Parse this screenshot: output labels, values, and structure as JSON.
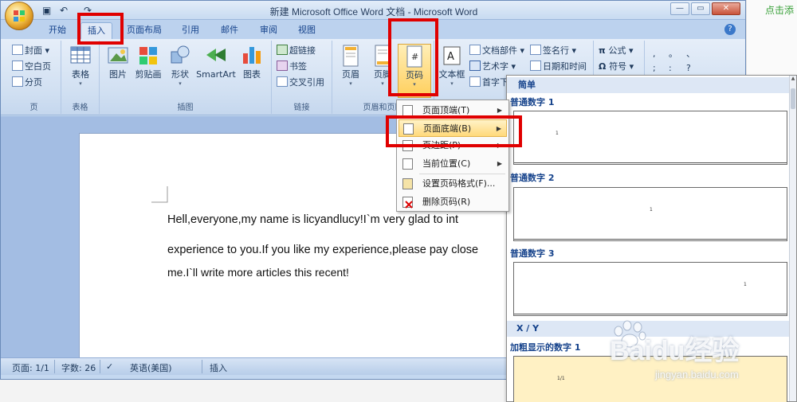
{
  "window": {
    "title": "新建 Microsoft Office Word 文档 - Microsoft Word",
    "controls": [
      "—",
      "▭",
      "✕"
    ]
  },
  "tabs": [
    "开始",
    "插入",
    "页面布局",
    "引用",
    "邮件",
    "审阅",
    "视图"
  ],
  "active_tab": "插入",
  "ribbon": {
    "pages_group": {
      "label": "页",
      "items": [
        "封面",
        "空白页",
        "分页"
      ]
    },
    "tables_group": {
      "label": "表格",
      "table_button": "表格"
    },
    "illustrations_group": {
      "label": "插图",
      "buttons": [
        "图片",
        "剪贴画",
        "形状",
        "SmartArt",
        "图表"
      ]
    },
    "links_group": {
      "label": "链接",
      "items": [
        "超链接",
        "书签",
        "交叉引用"
      ]
    },
    "header_footer_group": {
      "label": "页眉和页脚",
      "buttons": [
        "页眉",
        "页脚",
        "页码"
      ]
    },
    "text_group": {
      "textbox": "文本框",
      "items_col1": [
        "文档部件",
        "艺术字",
        "首字下沉"
      ],
      "items_col2": [
        "签名行",
        "日期和时间"
      ]
    },
    "symbols_group": {
      "items": [
        "公式",
        "符号"
      ],
      "punct_row1": [
        ",",
        "。",
        "、"
      ],
      "punct_row2": [
        ";",
        ":",
        "?"
      ]
    }
  },
  "document": {
    "line1": "Hell,everyone,my  name  is  licyandlucy!I`m  very  glad  to  int",
    "line2": "experience to you.If you like my experience,please  pay close",
    "line3": "me.I`ll write more articles this recent!"
  },
  "page_number_menu": {
    "items": [
      {
        "label": "页面顶端(T)",
        "submenu": true
      },
      {
        "label": "页面底端(B)",
        "submenu": true
      },
      {
        "label": "页边距(P)",
        "submenu": true
      },
      {
        "label": "当前位置(C)",
        "submenu": true
      },
      {
        "label": "设置页码格式(F)...",
        "submenu": false
      },
      {
        "label": "删除页码(R)",
        "submenu": false
      }
    ],
    "highlighted": "页面底端(B)"
  },
  "gallery": {
    "category_simple": "简单",
    "item1": "普通数字 1",
    "item2": "普通数字 2",
    "item3": "普通数字 3",
    "category_xy": "X / Y",
    "item4": "加粗显示的数字 1",
    "sample_number": "1",
    "sample_xy": "1/1"
  },
  "status_bar": {
    "page": "页面: 1/1",
    "words": "字数: 26",
    "language": "英语(美国)",
    "mode": "插入"
  },
  "side_link": "点击添",
  "watermark": {
    "text": "Baidu经验",
    "url": "jingyan.baidu.com"
  },
  "colors": {
    "ribbon_blue": "#c4d8f0",
    "highlight": "#ffd97a",
    "annotation_red": "#e00000"
  }
}
